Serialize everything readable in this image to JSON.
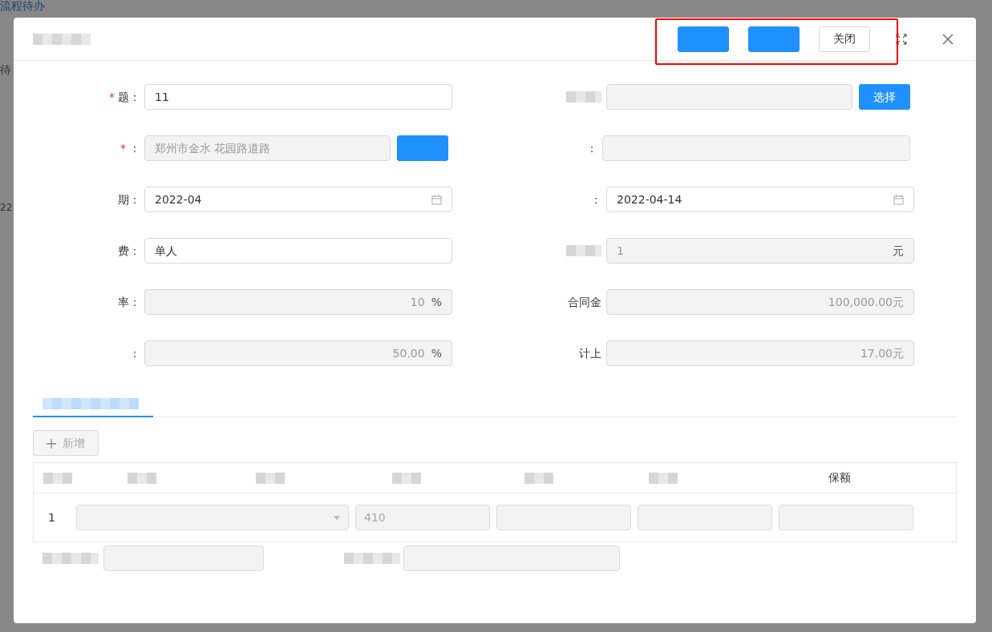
{
  "background": {
    "title": "流程待办",
    "tab": "待",
    "cell": "22"
  },
  "dialog": {
    "header_buttons": [
      {
        "kind": "primary"
      },
      {
        "kind": "primary"
      },
      {
        "kind": "default",
        "label": "关闭"
      }
    ],
    "rows": [
      {
        "left": {
          "label": "题：",
          "required_mark": "*",
          "kind": "text",
          "value": "11",
          "disabled": false
        },
        "right": {
          "kind": "text",
          "disabled": true,
          "button": {
            "label": "选择"
          }
        }
      },
      {
        "left": {
          "label": "：",
          "required_mark": "*",
          "kind": "text",
          "value": "郑州市金水 花园路道路",
          "disabled": true,
          "button": {
            "kind": "primary"
          }
        },
        "right": {
          "label": "：",
          "kind": "text",
          "disabled": true
        }
      },
      {
        "left": {
          "label": "期：",
          "kind": "date",
          "value": "2022-04",
          "disabled": false
        },
        "right": {
          "label": "：",
          "kind": "date",
          "value": "2022-04-14",
          "disabled": false
        }
      },
      {
        "left": {
          "label": "费：",
          "kind": "text",
          "value": "单人",
          "disabled": false
        },
        "right": {
          "kind": "text",
          "value": "1",
          "suffix": "元",
          "disabled": true
        }
      },
      {
        "left": {
          "label": "率：",
          "kind": "number",
          "value": "10",
          "suffix": "%",
          "disabled": true
        },
        "right": {
          "label": "合同金",
          "kind": "number",
          "value": "100,000.00元",
          "disabled": true
        }
      },
      {
        "left": {
          "label": "：",
          "kind": "number",
          "value": "50.00",
          "suffix": "%",
          "disabled": true
        },
        "right": {
          "label": "计上",
          "kind": "number",
          "value": "17.00元",
          "disabled": true
        }
      }
    ],
    "tabs": [
      {
        "selected": true
      }
    ],
    "add_button": {
      "label": "新增",
      "disabled": true
    },
    "table": {
      "columns": [
        {
          "kind": "hidden"
        },
        {
          "kind": "hidden"
        },
        {
          "kind": "hidden"
        },
        {
          "kind": "hidden"
        },
        {
          "kind": "hidden"
        },
        {
          "kind": "hidden"
        },
        {
          "kind": "text",
          "label": "保额"
        }
      ],
      "rows": [
        {
          "index": "1",
          "cells": [
            {
              "kind": "select"
            },
            {
              "kind": "input",
              "value": "410"
            },
            {
              "kind": "input"
            },
            {
              "kind": "input"
            },
            {
              "kind": "input"
            }
          ]
        }
      ]
    },
    "footer_fields": [
      {
        "kind": "input"
      },
      {
        "kind": "input"
      }
    ]
  }
}
